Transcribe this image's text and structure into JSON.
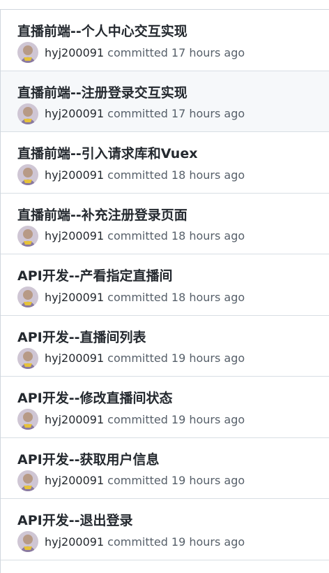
{
  "commits": [
    {
      "title": "直播前端--个人中心交互实现",
      "author": "hyj200091",
      "verb": "committed",
      "time": "17 hours ago"
    },
    {
      "title": "直播前端--注册登录交互实现",
      "author": "hyj200091",
      "verb": "committed",
      "time": "17 hours ago"
    },
    {
      "title": "直播前端--引入请求库和Vuex",
      "author": "hyj200091",
      "verb": "committed",
      "time": "18 hours ago"
    },
    {
      "title": "直播前端--补充注册登录页面",
      "author": "hyj200091",
      "verb": "committed",
      "time": "18 hours ago"
    },
    {
      "title": "API开发--产看指定直播间",
      "author": "hyj200091",
      "verb": "committed",
      "time": "18 hours ago"
    },
    {
      "title": "API开发--直播间列表",
      "author": "hyj200091",
      "verb": "committed",
      "time": "19 hours ago"
    },
    {
      "title": "API开发--修改直播间状态",
      "author": "hyj200091",
      "verb": "committed",
      "time": "19 hours ago"
    },
    {
      "title": "API开发--获取用户信息",
      "author": "hyj200091",
      "verb": "committed",
      "time": "19 hours ago"
    },
    {
      "title": "API开发--退出登录",
      "author": "hyj200091",
      "verb": "committed",
      "time": "19 hours ago"
    }
  ],
  "highlighted_index": 1,
  "colors": {
    "title": "#24292f",
    "muted": "#57606a",
    "border": "#d8dee4",
    "highlight_bg": "#f6f8fa"
  },
  "icons": {
    "avatar": "user-avatar"
  }
}
